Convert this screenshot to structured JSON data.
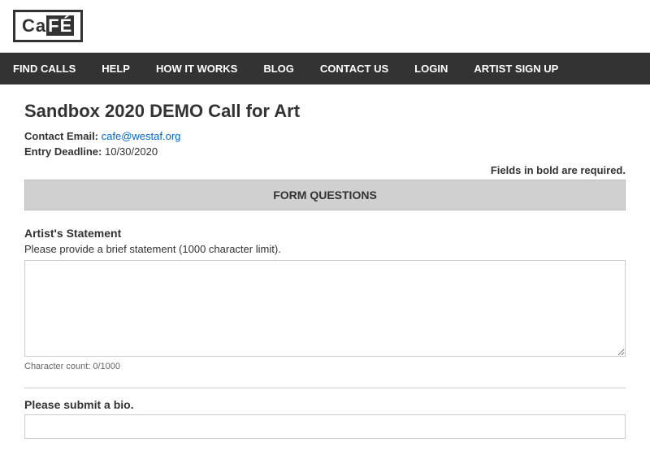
{
  "header": {
    "logo_text": "CaFÉ"
  },
  "nav": {
    "items": [
      {
        "label": "FIND CALLS",
        "href": "#"
      },
      {
        "label": "HELP",
        "href": "#"
      },
      {
        "label": "HOW IT WORKS",
        "href": "#"
      },
      {
        "label": "BLOG",
        "href": "#"
      },
      {
        "label": "CONTACT US",
        "href": "#"
      },
      {
        "label": "LOGIN",
        "href": "#"
      },
      {
        "label": "ARTIST SIGN UP",
        "href": "#"
      }
    ]
  },
  "page": {
    "title": "Sandbox 2020 DEMO Call for Art",
    "contact_label": "Contact Email:",
    "contact_email": "cafe@westaf.org",
    "deadline_label": "Entry Deadline:",
    "deadline_value": "10/30/2020",
    "required_note": "Fields in bold are required.",
    "form_questions_header": "FORM QUESTIONS",
    "artist_statement": {
      "label": "Artist's Statement",
      "hint": "Please provide a brief statement (1000 character limit).",
      "char_count": "Character count: 0/1000",
      "placeholder": ""
    },
    "bio": {
      "label": "Please submit a bio."
    }
  }
}
